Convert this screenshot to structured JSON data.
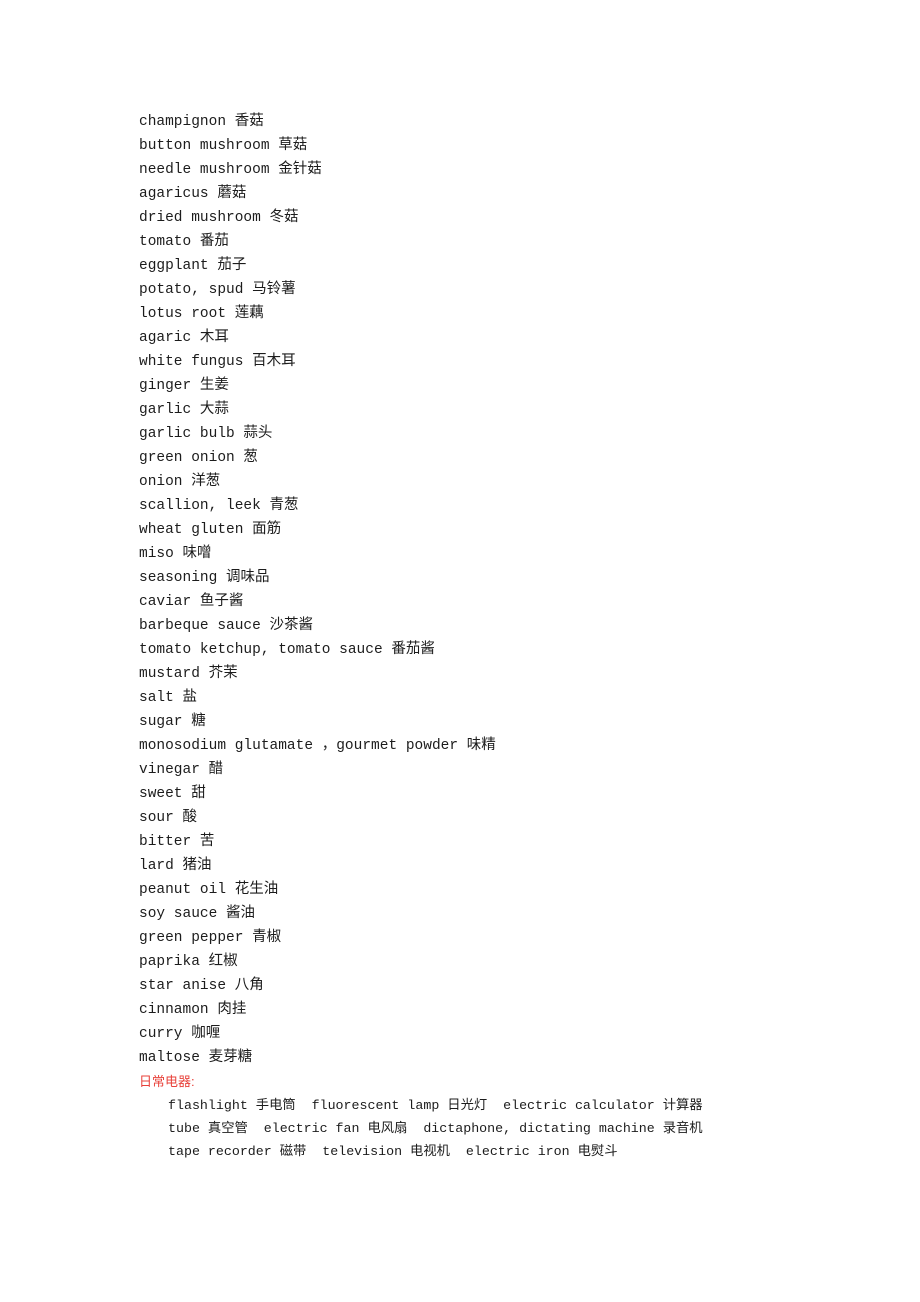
{
  "document": {
    "page_background": "#ffffff",
    "text_color": "#1c1c1c",
    "heading_color": "#e8413a"
  },
  "vocabulary": {
    "lines": [
      "champignon 香菇",
      "button mushroom 草菇",
      "needle mushroom 金针菇",
      "agaricus 蘑菇",
      "dried mushroom 冬菇",
      "tomato 番茄",
      "eggplant 茄子",
      "potato, spud 马铃薯",
      "lotus root 莲藕",
      "agaric 木耳",
      "white fungus 百木耳",
      "ginger 生姜",
      "garlic 大蒜",
      "garlic bulb 蒜头",
      "green onion 葱",
      "onion 洋葱",
      "scallion, leek 青葱",
      "wheat gluten 面筋",
      "miso 味噌",
      "seasoning 调味品",
      "caviar 鱼子酱",
      "barbeque sauce 沙茶酱",
      "tomato ketchup, tomato sauce 番茄酱",
      "mustard 芥茉",
      "salt 盐",
      "sugar 糖",
      "monosodium glutamate ，gourmet powder 味精",
      "vinegar 醋",
      "sweet 甜",
      "sour 酸",
      "bitter 苦",
      "lard 猪油",
      "peanut oil 花生油",
      "soy sauce 酱油",
      "green pepper 青椒",
      "paprika 红椒",
      "star anise 八角",
      "cinnamon 肉挂",
      "curry 咖喱",
      "maltose 麦芽糖"
    ]
  },
  "appliances_section": {
    "heading": "日常电器:",
    "lines": [
      "flashlight 手电筒  fluorescent lamp 日光灯  electric calculator 计算器",
      "tube 真空管  electric fan 电风扇  dictaphone, dictating machine 录音机",
      "tape recorder 磁带  television 电视机  electric iron 电熨斗"
    ]
  }
}
